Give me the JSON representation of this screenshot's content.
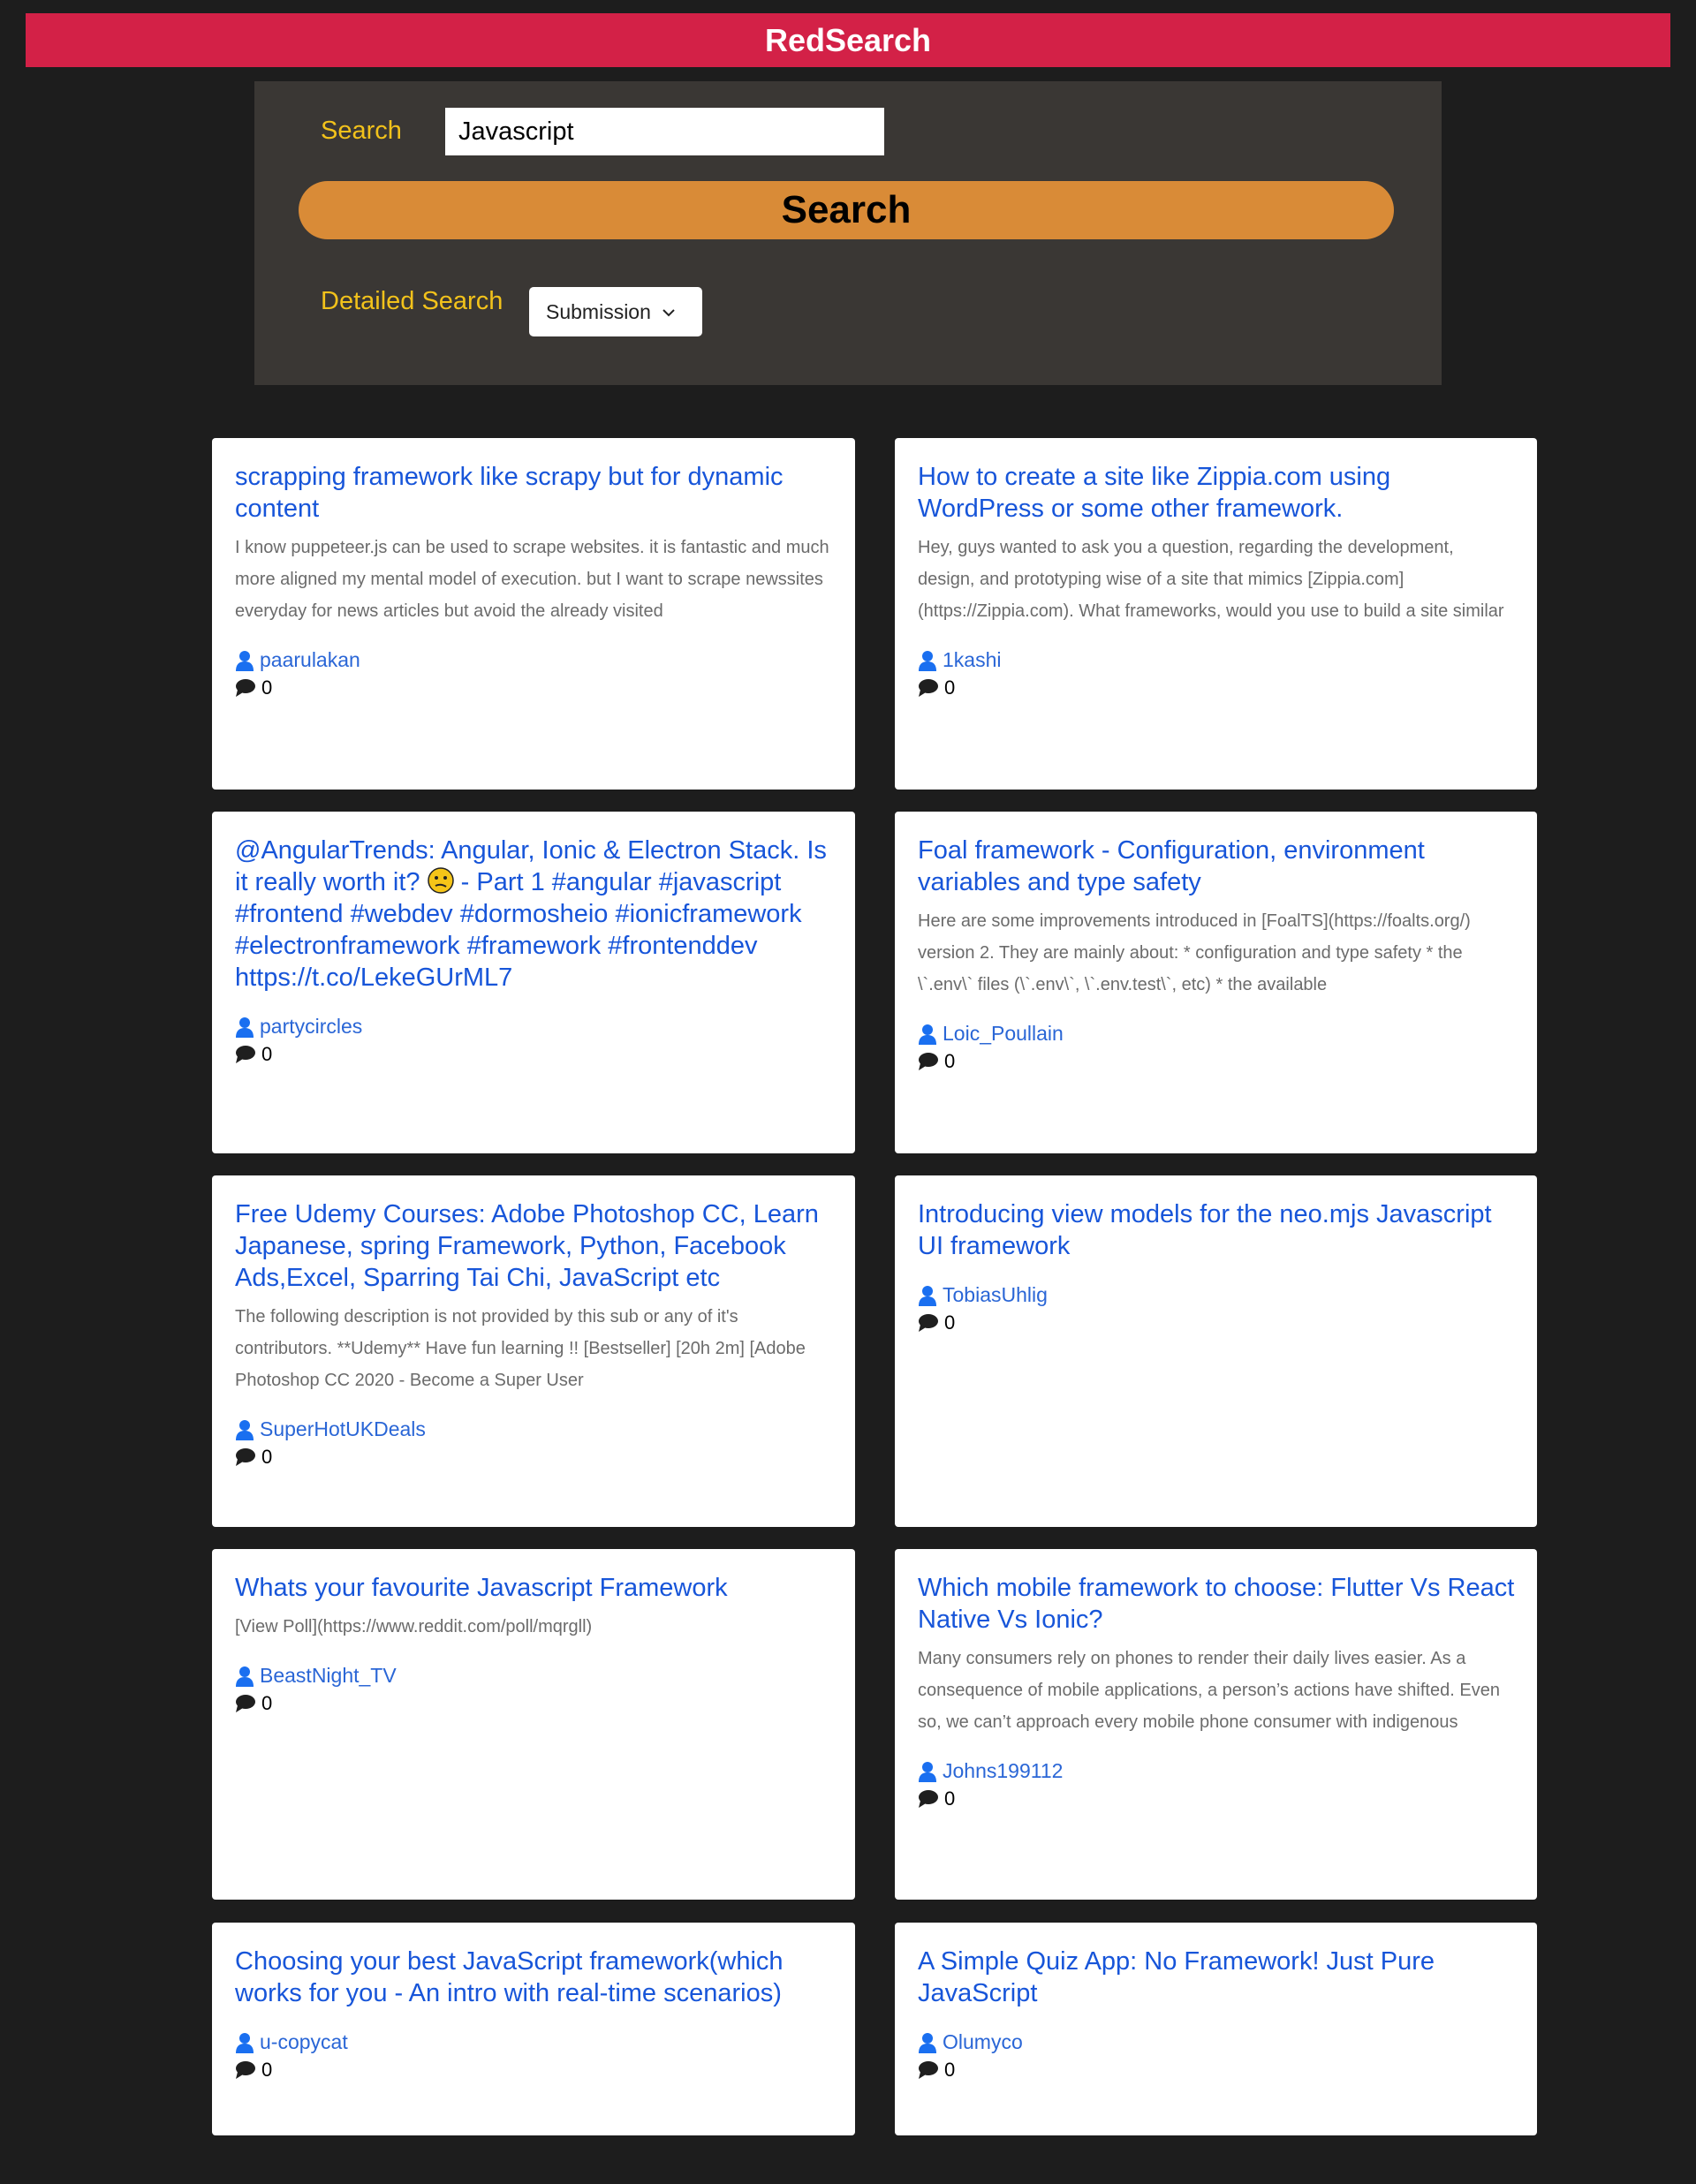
{
  "header": {
    "title": "RedSearch"
  },
  "search": {
    "label": "Search",
    "value": "Javascript",
    "button_label": "Search",
    "detailed_label": "Detailed Search",
    "detailed_selected": "Submission"
  },
  "icons": {
    "author": "user-icon",
    "comments": "comment-icon",
    "dropdown": "chevron-down-icon",
    "emoji": "confused-face-emoji"
  },
  "colors": {
    "page_background": "#1d1d1d",
    "header_background": "#d32147",
    "panel_background": "#3a3734",
    "label_color": "#f2c21b",
    "button_color": "#d98b37",
    "title_link_color": "#1755d9"
  },
  "results": [
    {
      "title": "scrapping framework like scrapy but for dynamic content",
      "description": "I know puppeteer.js can be used to scrape websites. it is fantastic and much more aligned my mental model of execution. but I want to scrape newssites everyday for news articles but avoid the already visited",
      "author": "paarulakan",
      "comments": "0"
    },
    {
      "title": "How to create a site like Zippia.com using WordPress or some other framework.",
      "description": "Hey, guys wanted to ask you a question, regarding the development, design, and prototyping wise of a site that mimics [Zippia.com](https://Zippia.com). What frameworks, would you use to build a site similar",
      "author": "1kashi",
      "comments": "0"
    },
    {
      "title_before_emoji": "@AngularTrends: Angular, Ionic & Electron Stack. Is it really worth it?",
      "title_after_emoji": "- Part 1 #angular #javascript #frontend #webdev #dormosheio #ionicframework #electronframework #framework #frontenddev https://t.co/LekeGUrML7",
      "author": "partycircles",
      "comments": "0"
    },
    {
      "title": "Foal framework - Configuration, environment variables and type safety",
      "description": "Here are some improvements introduced in [FoalTS](https://foalts.org/) version 2. They are mainly about: * configuration and type safety * the \\`.env\\` files (\\`.env\\`, \\`.env.test\\`, etc) * the available",
      "author": "Loic_Poullain",
      "comments": "0"
    },
    {
      "title": "Free Udemy Courses: Adobe Photoshop CC, Learn Japanese, spring Framework, Python, Facebook Ads,Excel, Sparring Tai Chi, JavaScript etc",
      "description": "The following description is not provided by this sub or any of it's contributors. **Udemy** Have fun learning !! [Bestseller] [20h 2m] [Adobe Photoshop CC 2020 - Become a Super User",
      "author": "SuperHotUKDeals",
      "comments": "0"
    },
    {
      "title": "Introducing view models for the neo.mjs Javascript UI framework",
      "author": "TobiasUhlig",
      "comments": "0"
    },
    {
      "title": "Whats your favourite Javascript Framework",
      "description": "[View Poll](https://www.reddit.com/poll/mqrgll)",
      "author": "BeastNight_TV",
      "comments": "0"
    },
    {
      "title": "Which mobile framework to choose: Flutter Vs React Native Vs Ionic?",
      "description": "Many consumers rely on phones to render their daily lives easier. As a consequence of mobile applications, a person’s actions have shifted. Even so, we can’t approach every mobile phone consumer with indigenous",
      "author": "Johns199112",
      "comments": "0"
    },
    {
      "title": "Choosing your best JavaScript framework(which works for you - An intro with real-time scenarios)",
      "author": "u-copycat",
      "comments": "0"
    },
    {
      "title": "A Simple Quiz App: No Framework! Just Pure JavaScript",
      "author": "Olumyco",
      "comments": "0"
    }
  ]
}
